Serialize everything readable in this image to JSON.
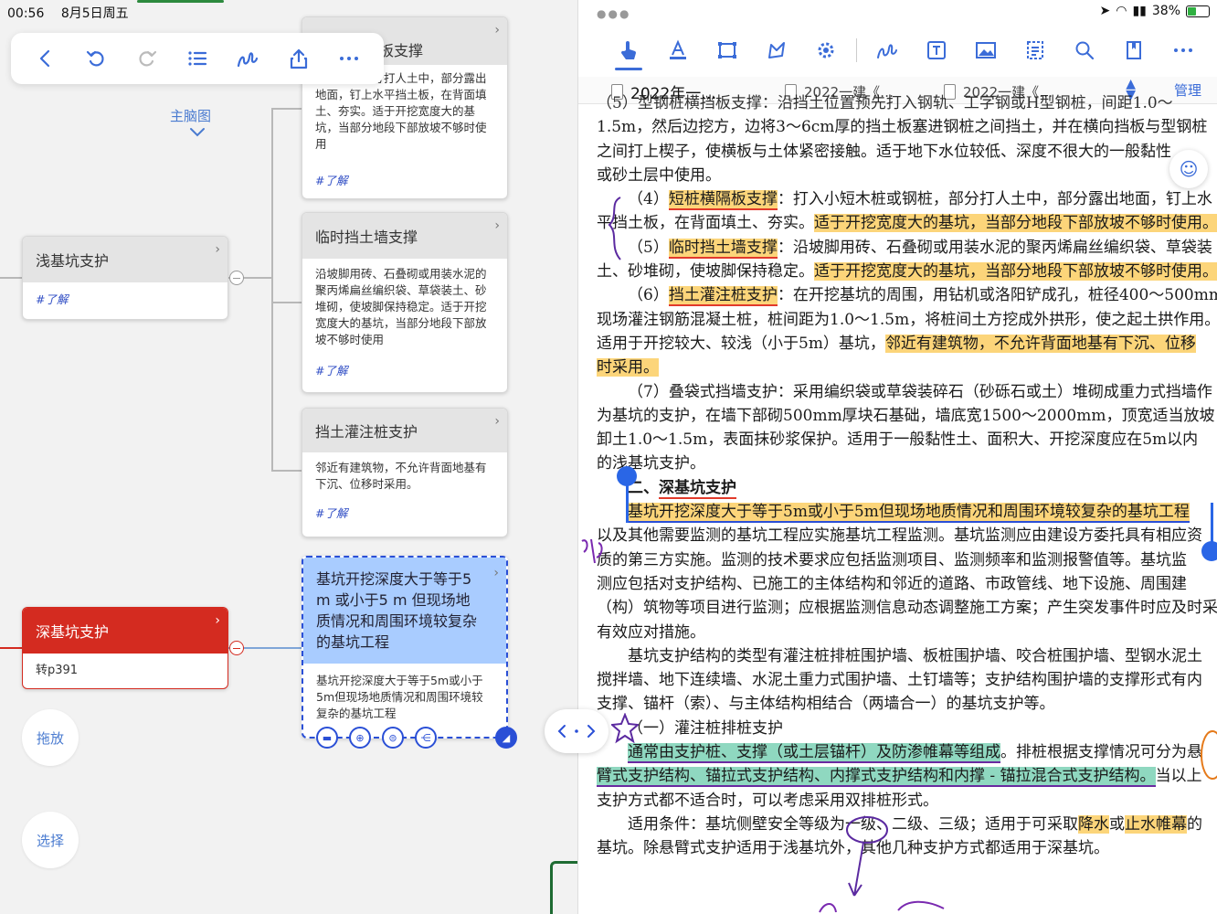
{
  "status": {
    "time": "00:56",
    "date": "8月5日周五",
    "battery": "38%"
  },
  "left_toolbar": {
    "icons": [
      "back-icon",
      "undo-icon",
      "redo-icon",
      "outline-list-icon",
      "pen-icon",
      "share-icon",
      "more-icon"
    ]
  },
  "mindmap": {
    "main_map_label": "主脑图",
    "shallow": {
      "title": "浅基坑支护",
      "tag": "#了解"
    },
    "deep": {
      "title": "深基坑支护",
      "note": "转p391"
    },
    "partial_card": {
      "title_visible": "板支撑",
      "body": "或钢桩，部分打人土中，部分露出地面，钉上水平挡土板，在背面填土、夯实。适于开挖宽度大的基坑，当部分地段下部放坡不够时使用",
      "tag": "#了解"
    },
    "temp_wall": {
      "title": "临时挡土墙支撑",
      "body": "沿坡脚用砖、石叠砌或用装水泥的聚丙烯扁丝编织袋、草袋装土、砂堆砌，使坡脚保持稳定。适于开挖宽度大的基坑，当部分地段下部放坡不够时使用",
      "tag": "#了解"
    },
    "pile": {
      "title": "挡土灌注桩支护",
      "body": "邻近有建筑物，不允许背面地基有下沉、位移时采用。",
      "tag": "#了解"
    },
    "selected": {
      "title": "基坑开挖深度大于等于5 m 或小于5 m 但现场地质情况和周围环境较复杂的基坑工程",
      "body": "基坑开挖深度大于等于5m或小于5m但现场地质情况和周围环境较复杂的基坑工程"
    },
    "buttons": {
      "drag": "拖放",
      "select": "选择"
    }
  },
  "pdf_toolbar": {
    "icons": [
      "hand-icon",
      "text-highlight-icon",
      "rect-select-icon",
      "lasso-icon",
      "settings-gear-icon",
      "pen-icon",
      "text-box-icon",
      "image-icon",
      "outline-icon",
      "search-icon",
      "bookmark-icon",
      "more-icon"
    ]
  },
  "tabs": {
    "items": [
      "2022年一…",
      "2022一建《…",
      "2022一建《…"
    ],
    "manage": "管理"
  },
  "pdf": {
    "lines": {
      "l0": "（5）型钢桩横挡板支撑：沿挡土位置预先打入钢轨、工字钢或H型钢桩，间距1.0～",
      "l1": "1.5m，然后边挖方，边将3～6cm厚的挡土板塞进钢桩之间挡土，并在横向挡板与型钢桩",
      "l2": "之间打上楔子，使横板与土体紧密接触。适于地下水位较低、深度不很大的一般黏性",
      "l3": "或砂土层中使用。",
      "l4a": "（4）",
      "l4b": "短桩横隔板支撑",
      "l4c": "：打入小短木桩或钢桩，部分打人土中，部分露出地面，钉上水",
      "l5a": "平挡土板，在背面填土、夯实。",
      "l5b": "适于开挖宽度大的基坑，当部分地段下部放坡不够时使用。",
      "l6a": "（5）",
      "l6b": "临时挡土墙支撑",
      "l6c": "：沿坡脚用砖、石叠砌或用装水泥的聚丙烯扁丝编织袋、草袋装",
      "l7a": "土、砂堆砌，使坡脚保持稳定。",
      "l7b": "适于开挖宽度大的基坑，当部分地段下部放坡不够时使用。",
      "l8a": "（6）",
      "l8b": "挡土灌注桩支护",
      "l8c": "：在开挖基坑的周围，用钻机或洛阳铲成孔，桩径400～500mm，",
      "l9": "现场灌注钢筋混凝土桩，桩间距为1.0～1.5m，将桩间土方挖成外拱形，使之起土拱作用。",
      "l10a": "适用于开挖较大、较浅（小于5m）基坑，",
      "l10b": "邻近有建筑物，不允许背面地基有下沉、位移",
      "l11": "时采用。",
      "l12": "（7）叠袋式挡墙支护：采用编织袋或草袋装碎石（砂砾石或土）堆砌成重力式挡墙作",
      "l13": "为基坑的支护，在墙下部砌500mm厚块石基础，墙底宽1500～2000mm，顶宽适当放坡",
      "l14": "卸土1.0～1.5m，表面抹砂浆保护。适用于一般黏性土、面积大、开挖深度应在5m以内",
      "l15": "的浅基坑支护。",
      "l16a": "二、",
      "l16b": "深基坑支护",
      "l17": "基坑开挖深度大于等于5m或小于5m但现场地质情况和周围环境较复杂的基坑工程",
      "l18": "以及其他需要监测的基坑工程应实施基坑工程监测。基坑监测应由建设方委托具有相应资",
      "l19": "质的第三方实施。监测的技术要求应包括监测项目、监测频率和监测报警值等。基坑监",
      "l20": "测应包括对支护结构、已施工的主体结构和邻近的道路、市政管线、地下设施、周围建",
      "l21": "（构）筑物等项目进行监测；应根据监测信息动态调整施工方案；产生突发事件时应及时采取",
      "l22": "有效应对措施。",
      "l23": "基坑支护结构的类型有灌注桩排桩围护墙、板桩围护墙、咬合桩围护墙、型钢水泥土",
      "l24": "搅拌墙、地下连续墙、水泥土重力式围护墙、土钉墙等；支护结构围护墙的支撑形式有内",
      "l25": "支撑、锚杆（索）、与主体结构相结合（两墙合一）的基坑支护等。",
      "l26": "（一）灌注桩排桩支护",
      "l27a": "通常由支护桩、支撑（或土层锚杆）及防渗帷幕等组成",
      "l27b": "。排桩根据支撑情况可分为悬",
      "l28a": "臂式支护结构、锚拉式支护结构、内撑式支护结构和内撑 - 锚拉混合式支护结构。",
      "l28b": "当以上",
      "l29": "支护方式都不适合时，可以考虑采用双排桩形式。",
      "l30a": "适用条件：基坑侧壁安全等级为一级、二级、三级；适用于可采取",
      "l30b": "降水",
      "l30c": "或",
      "l30d": "止水帷幕",
      "l30e": "的",
      "l31": "基坑。除悬臂式支护适用于浅基坑外，其他几种支护方式都适用于深基坑。"
    }
  }
}
